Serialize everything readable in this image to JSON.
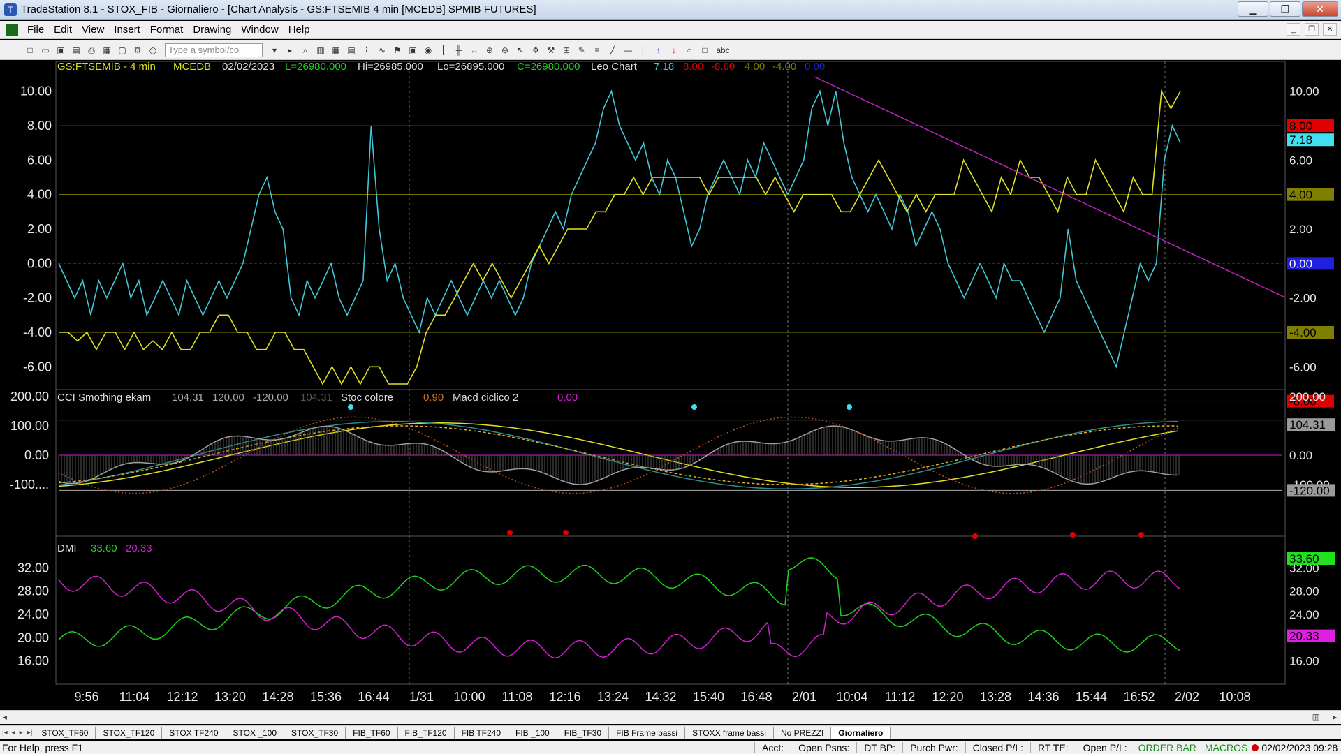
{
  "window": {
    "title": "TradeStation 8.1 - STOX_FIB - Giornaliero - [Chart Analysis - GS:FTSEMIB  4 min  [MCEDB] SPMIB FUTURES]",
    "minimize": "▁",
    "maximize": "❐",
    "close": "✕"
  },
  "menu": [
    "File",
    "Edit",
    "View",
    "Insert",
    "Format",
    "Drawing",
    "Window",
    "Help"
  ],
  "toolbar": {
    "symbol_placeholder": "Type a symbol/co",
    "text_tool": "abc"
  },
  "colors": {
    "cyan": "#40c8d8",
    "yellow": "#e0e020",
    "red": "#e00000",
    "magenta": "#d020d0",
    "green": "#20d020",
    "trendline": "#c020c0"
  },
  "price_panel": {
    "symbol": "GS:FTSEMIB - 4 min",
    "feed": "MCEDB",
    "date": "02/02/2023",
    "last": "L=26980.000",
    "high": "Hi=26985.000",
    "low": "Lo=26895.000",
    "close": "C=26980.000",
    "study": "Leo Chart",
    "v1": "7.18",
    "v2": "8.00",
    "v3": "-8.00",
    "v4": "4.00",
    "v5": "-4.00",
    "v6": "0.00",
    "y_ticks": [
      "10.00",
      "8.00",
      "6.00",
      "4.00",
      "2.00",
      "0.00",
      "-2.00",
      "-4.00",
      "-6.00"
    ],
    "right_markers": [
      "8.00",
      "7.18",
      "4.00",
      "0.00",
      "-4.00",
      "-8.00"
    ]
  },
  "cci_panel": {
    "name": "CCI Smothing ekam",
    "v1": "104.31",
    "v2": "120.00",
    "v3": "-120.00",
    "v4": "104.31",
    "stoc": "Stoc colore",
    "stoc_val": "0.90",
    "macd": "Macd ciclico 2",
    "macd_val": "0.00",
    "y_ticks": [
      "200.00",
      "100.00",
      "0.00",
      "-100...."
    ],
    "right_markers": [
      "104.31",
      "-120.00"
    ],
    "right_ticks": [
      "200.00",
      "0.00",
      "-100.00"
    ]
  },
  "dmi_panel": {
    "name": "DMI",
    "v1": "33.60",
    "v2": "20.33",
    "y_ticks": [
      "32.00",
      "28.00",
      "24.00",
      "20.00",
      "16.00"
    ],
    "right_markers": [
      "33.60",
      "20.33"
    ]
  },
  "chart_data": {
    "type": "line",
    "x_ticks": [
      "9:56",
      "11:04",
      "12:12",
      "13:20",
      "14:28",
      "15:36",
      "16:44",
      "1/31",
      "10:00",
      "11:08",
      "12:16",
      "13:24",
      "14:32",
      "15:40",
      "16:48",
      "2/01",
      "10:04",
      "11:12",
      "12:20",
      "13:28",
      "14:36",
      "15:44",
      "16:52",
      "2/02",
      "10:08"
    ],
    "price_panel_ylim": [
      -7,
      11
    ],
    "price_panel_hlines": [
      8,
      4,
      0,
      -4,
      -8
    ],
    "oscillator_cyan": [
      0,
      -1,
      -2,
      -1,
      -3,
      -1,
      -2,
      -1,
      0,
      -2,
      -1,
      -3,
      -2,
      -1,
      -2,
      -3,
      -1,
      -2,
      -3,
      -2,
      -1,
      -2,
      -1,
      0,
      2,
      4,
      5,
      3,
      2,
      -2,
      -3,
      -1,
      -2,
      -1,
      0,
      -2,
      -3,
      -2,
      -1,
      8,
      2,
      -1,
      0,
      -2,
      -3,
      -4,
      -2,
      -3,
      -2,
      -1,
      -2,
      -3,
      -2,
      -1,
      -2,
      -1,
      -2,
      -3,
      -2,
      0,
      1,
      2,
      3,
      2,
      4,
      5,
      6,
      7,
      9,
      10,
      8,
      7,
      6,
      7,
      5,
      4,
      6,
      5,
      3,
      1,
      2,
      4,
      5,
      6,
      5,
      4,
      6,
      5,
      7,
      6,
      5,
      4,
      5,
      6,
      9,
      10,
      8,
      10,
      7,
      5,
      4,
      3,
      4,
      3,
      2,
      4,
      3,
      1,
      2,
      3,
      2,
      0,
      -1,
      -2,
      -1,
      0,
      -1,
      -2,
      0,
      -1,
      -1,
      -2,
      -3,
      -4,
      -3,
      -2,
      2,
      -1,
      -2,
      -3,
      -4,
      -5,
      -6,
      -4,
      -2,
      0,
      -1,
      0,
      6,
      8,
      7
    ],
    "oscillator_yellow": [
      -4,
      -4,
      -4.5,
      -4,
      -5,
      -4,
      -4,
      -5,
      -4,
      -5,
      -4.5,
      -5,
      -4,
      -5,
      -5,
      -4,
      -4,
      -3,
      -3,
      -4,
      -4,
      -5,
      -5,
      -4,
      -4,
      -5,
      -5,
      -6,
      -7,
      -6,
      -7,
      -6,
      -7,
      -6,
      -6,
      -7,
      -7,
      -7,
      -6,
      -4,
      -3,
      -3,
      -2,
      -1,
      0,
      -1,
      0,
      -1,
      -2,
      -1,
      0,
      1,
      0,
      1,
      2,
      2,
      2,
      3,
      3,
      4,
      4,
      5,
      4,
      5,
      5,
      5,
      5,
      5,
      5,
      4,
      5,
      5,
      5,
      5,
      5,
      4,
      5,
      4,
      3,
      4,
      4,
      4,
      4,
      3,
      3,
      4,
      5,
      6,
      5,
      4,
      3,
      4,
      3,
      4,
      4,
      4,
      6,
      5,
      4,
      3,
      5,
      4,
      6,
      5,
      5,
      4,
      3,
      5,
      4,
      4,
      6,
      5,
      4,
      3,
      5,
      4,
      4,
      10,
      9,
      10
    ],
    "series": [
      {
        "name": "DMI",
        "values": [
          33.6,
          20.33
        ]
      }
    ]
  },
  "tabs": [
    "STOX_TF60",
    "STOX_TF120",
    "STOX TF240",
    "STOX _100",
    "STOX_TF30",
    "FIB_TF60",
    "FIB_TF120",
    "FIB TF240",
    "FIB _100",
    "FIB_TF30",
    "FIB Frame bassi",
    "STOXX frame bassi",
    "No PREZZI",
    "Giornaliero"
  ],
  "status": {
    "help": "For Help, press F1",
    "acct": "Acct:",
    "open_psns": "Open Psns:",
    "dt_bp": "DT BP:",
    "purch_pwr": "Purch Pwr:",
    "closed_pl": "Closed P/L:",
    "rt_te": "RT TE:",
    "open_pl": "Open P/L:",
    "order_bar": "ORDER BAR",
    "macros": "MACROS",
    "datetime": "02/02/2023 09:28"
  }
}
